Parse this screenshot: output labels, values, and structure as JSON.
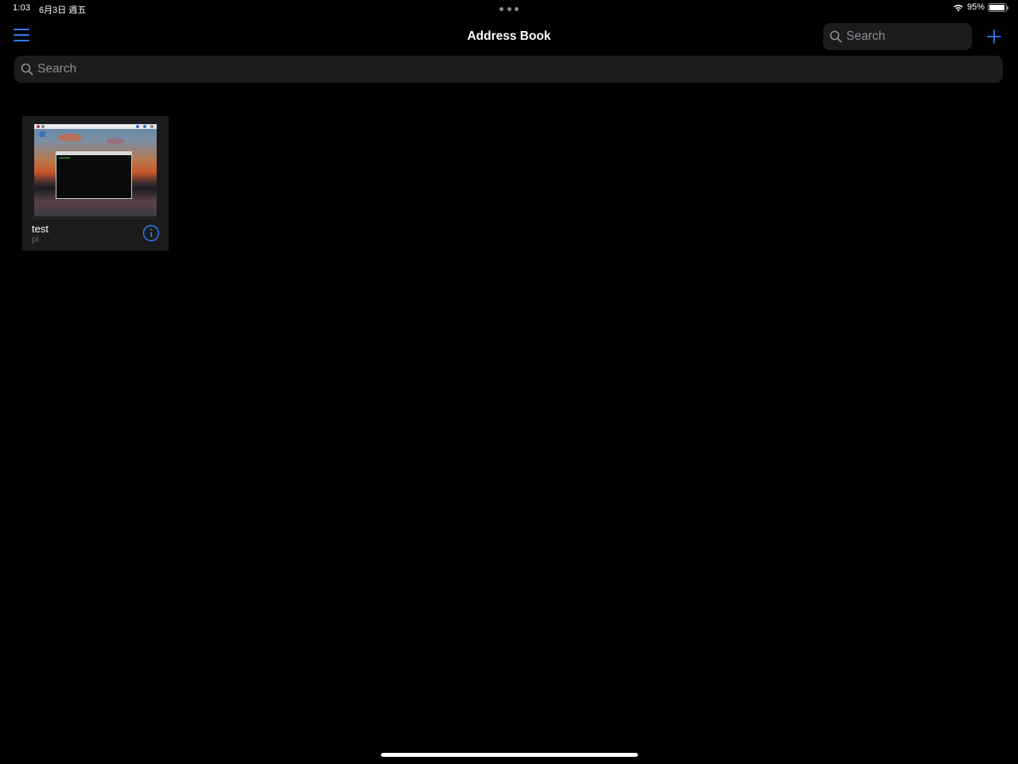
{
  "status_bar": {
    "time": "1:03",
    "date": "6月3日 週五",
    "battery_percent": "95%",
    "battery_level": 0.95,
    "wifi_icon": "wifi-icon",
    "battery_icon": "battery-icon"
  },
  "nav_bar": {
    "title": "Address Book",
    "menu_icon": "hamburger-menu-icon",
    "search_placeholder": "Search",
    "add_icon": "plus-icon"
  },
  "main_search": {
    "placeholder": "Search"
  },
  "connections": [
    {
      "name": "test",
      "username": "pi",
      "info_icon": "info-icon"
    }
  ],
  "colors": {
    "accent": "#2f7cf6",
    "background": "#000000",
    "field_background": "#1c1c1e",
    "placeholder_text": "#8e8e93",
    "secondary_text": "#636366"
  }
}
